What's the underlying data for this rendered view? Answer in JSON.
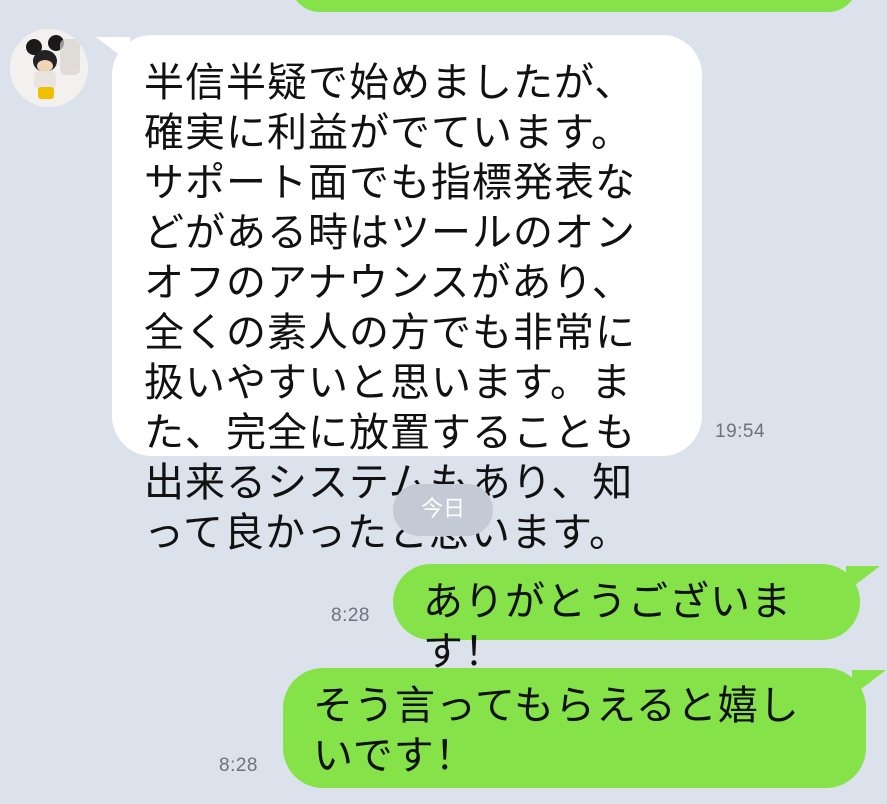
{
  "messages": [
    {
      "direction": "incoming",
      "text": "半信半疑で始めましたが、確実に利益がでています。サポート面でも指標発表などがある時はツールのオンオフのアナウンスがあり、全くの素人の方でも非常に扱いやすいと思います。また、完全に放置することも出来るシステムもあり、知って良かったと思います。",
      "time": "19:54"
    },
    {
      "direction": "outgoing",
      "text": "ありがとうございます！",
      "time": "8:28"
    },
    {
      "direction": "outgoing",
      "text": "そう言ってもらえると嬉しいです！",
      "time": "8:28"
    }
  ],
  "date_separator": "今日",
  "colors": {
    "background": "#dce2ec",
    "incoming_bubble": "#ffffff",
    "outgoing_bubble": "#85e249",
    "date_pill": "#c3cad5",
    "timestamp": "#6b7380"
  }
}
